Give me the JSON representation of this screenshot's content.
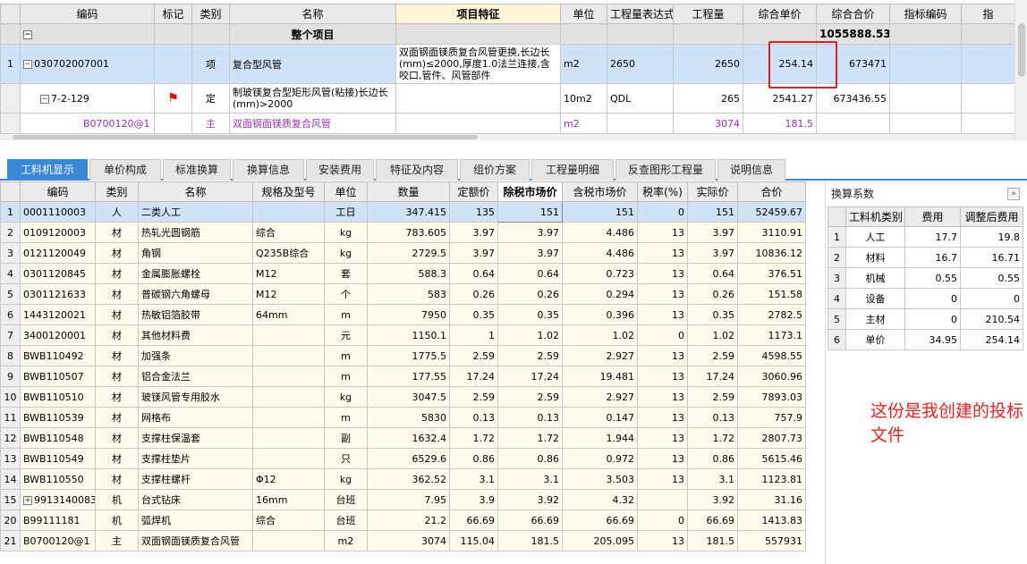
{
  "top_grid": {
    "headers": [
      "编码",
      "标记",
      "类别",
      "名称",
      "项目特征",
      "单位",
      "工程量表达式",
      "工程量",
      "综合单价",
      "综合合价",
      "指标编码",
      "指"
    ],
    "total_row": {
      "name": "整个项目",
      "total": "1055888.53"
    },
    "row1": {
      "num": "1",
      "code": "030702007001",
      "type": "项",
      "name": "复合型风管",
      "feature": "双面钢面镁质复合风管更换,长边长(mm)≤2000,厚度1.0法兰连接,含咬口,管件、风管部件",
      "unit": "m2",
      "expr": "2650",
      "qty": "2650",
      "price": "254.14",
      "total": "673471"
    },
    "row2": {
      "code": "7-2-129",
      "type": "定",
      "name": "制玻镁复合型矩形风管(粘接)长边长(mm)>2000",
      "unit": "10m2",
      "expr": "QDL",
      "qty": "265",
      "price": "2541.27",
      "total": "673436.55"
    },
    "row3": {
      "code": "B0700120@1",
      "type": "主",
      "name": "双面钢面镁质复合风管",
      "unit": "m2",
      "qty": "3074",
      "price": "181.5"
    }
  },
  "tabs": [
    "工料机显示",
    "单价构成",
    "标准换算",
    "换算信息",
    "安装费用",
    "特征及内容",
    "组价方案",
    "工程量明细",
    "反查图形工程量",
    "说明信息"
  ],
  "bottom_grid": {
    "headers": [
      "编码",
      "类别",
      "名称",
      "规格及型号",
      "单位",
      "数量",
      "定额价",
      "除税市场价",
      "含税市场价",
      "税率(%)",
      "实际价",
      "合价"
    ],
    "rows": [
      {
        "n": "1",
        "code": "0001110003",
        "type": "人",
        "name": "二类人工",
        "spec": "",
        "unit": "工日",
        "qty": "347.415",
        "base": "135",
        "mkt": "151",
        "mkt_tax": "151",
        "rate": "0",
        "real": "151",
        "total": "52459.67"
      },
      {
        "n": "2",
        "code": "0109120003",
        "type": "材",
        "name": "热轧光圆钢筋",
        "spec": "综合",
        "unit": "kg",
        "qty": "783.605",
        "base": "3.97",
        "mkt": "3.97",
        "mkt_tax": "4.486",
        "rate": "13",
        "real": "3.97",
        "total": "3110.91"
      },
      {
        "n": "3",
        "code": "0121120049",
        "type": "材",
        "name": "角钢",
        "spec": "Q235B综合",
        "unit": "kg",
        "qty": "2729.5",
        "base": "3.97",
        "mkt": "3.97",
        "mkt_tax": "4.486",
        "rate": "13",
        "real": "3.97",
        "total": "10836.12"
      },
      {
        "n": "4",
        "code": "0301120845",
        "type": "材",
        "name": "金属膨胀螺栓",
        "spec": "M12",
        "unit": "套",
        "qty": "588.3",
        "base": "0.64",
        "mkt": "0.64",
        "mkt_tax": "0.723",
        "rate": "13",
        "real": "0.64",
        "total": "376.51"
      },
      {
        "n": "5",
        "code": "0301121633",
        "type": "材",
        "name": "普碳钢六角螺母",
        "spec": "M12",
        "unit": "个",
        "qty": "583",
        "base": "0.26",
        "mkt": "0.26",
        "mkt_tax": "0.294",
        "rate": "13",
        "real": "0.26",
        "total": "151.58"
      },
      {
        "n": "6",
        "code": "1443120021",
        "type": "材",
        "name": "热敏铝箔胶带",
        "spec": "64mm",
        "unit": "m",
        "qty": "7950",
        "base": "0.35",
        "mkt": "0.35",
        "mkt_tax": "0.396",
        "rate": "13",
        "real": "0.35",
        "total": "2782.5"
      },
      {
        "n": "7",
        "code": "3400120001",
        "type": "材",
        "name": "其他材料费",
        "spec": "",
        "unit": "元",
        "qty": "1150.1",
        "base": "1",
        "mkt": "1.02",
        "mkt_tax": "1.02",
        "rate": "0",
        "real": "1.02",
        "total": "1173.1"
      },
      {
        "n": "8",
        "code": "BWB110492",
        "type": "材",
        "name": "加强条",
        "spec": "",
        "unit": "m",
        "qty": "1775.5",
        "base": "2.59",
        "mkt": "2.59",
        "mkt_tax": "2.927",
        "rate": "13",
        "real": "2.59",
        "total": "4598.55"
      },
      {
        "n": "9",
        "code": "BWB110507",
        "type": "材",
        "name": "铝合金法兰",
        "spec": "",
        "unit": "m",
        "qty": "177.55",
        "base": "17.24",
        "mkt": "17.24",
        "mkt_tax": "19.481",
        "rate": "13",
        "real": "17.24",
        "total": "3060.96"
      },
      {
        "n": "10",
        "code": "BWB110510",
        "type": "材",
        "name": "玻镁风管专用胶水",
        "spec": "",
        "unit": "kg",
        "qty": "3047.5",
        "base": "2.59",
        "mkt": "2.59",
        "mkt_tax": "2.927",
        "rate": "13",
        "real": "2.59",
        "total": "7893.03"
      },
      {
        "n": "11",
        "code": "BWB110539",
        "type": "材",
        "name": "网格布",
        "spec": "",
        "unit": "m",
        "qty": "5830",
        "base": "0.13",
        "mkt": "0.13",
        "mkt_tax": "0.147",
        "rate": "13",
        "real": "0.13",
        "total": "757.9"
      },
      {
        "n": "12",
        "code": "BWB110548",
        "type": "材",
        "name": "支撑柱保温套",
        "spec": "",
        "unit": "副",
        "qty": "1632.4",
        "base": "1.72",
        "mkt": "1.72",
        "mkt_tax": "1.944",
        "rate": "13",
        "real": "1.72",
        "total": "2807.73"
      },
      {
        "n": "13",
        "code": "BWB110549",
        "type": "材",
        "name": "支撑柱垫片",
        "spec": "",
        "unit": "只",
        "qty": "6529.6",
        "base": "0.86",
        "mkt": "0.86",
        "mkt_tax": "0.972",
        "rate": "13",
        "real": "0.86",
        "total": "5615.46"
      },
      {
        "n": "14",
        "code": "BWB110550",
        "type": "材",
        "name": "支撑柱螺杆",
        "spec": "Φ12",
        "unit": "kg",
        "qty": "362.52",
        "base": "3.1",
        "mkt": "3.1",
        "mkt_tax": "3.503",
        "rate": "13",
        "real": "3.1",
        "total": "1123.81"
      },
      {
        "n": "15",
        "code": "9913140083",
        "type": "机",
        "name": "台式钻床",
        "spec": "16mm",
        "unit": "台班",
        "qty": "7.95",
        "base": "3.9",
        "mkt": "3.92",
        "mkt_tax": "4.32",
        "rate": "",
        "real": "3.92",
        "total": "31.16",
        "expand": "+"
      },
      {
        "n": "20",
        "code": "B99111181",
        "type": "机",
        "name": "弧焊机",
        "spec": "综合",
        "unit": "台班",
        "qty": "21.2",
        "base": "66.69",
        "mkt": "66.69",
        "mkt_tax": "66.69",
        "rate": "0",
        "real": "66.69",
        "total": "1413.83"
      },
      {
        "n": "21",
        "code": "B0700120@1",
        "type": "主",
        "name": "双面钢面镁质复合风管",
        "spec": "",
        "unit": "m2",
        "qty": "3074",
        "base": "115.04",
        "mkt": "181.5",
        "mkt_tax": "205.095",
        "rate": "13",
        "real": "181.5",
        "total": "557931"
      }
    ]
  },
  "right_panel": {
    "title": "换算系数",
    "collapse_icon": "»",
    "headers": [
      "工料机类别",
      "费用",
      "调整后费用"
    ],
    "rows": [
      {
        "n": "1",
        "cat": "人工",
        "fee": "17.7",
        "adj": "19.8"
      },
      {
        "n": "2",
        "cat": "材料",
        "fee": "16.7",
        "adj": "16.71"
      },
      {
        "n": "3",
        "cat": "机械",
        "fee": "0.55",
        "adj": "0.55"
      },
      {
        "n": "4",
        "cat": "设备",
        "fee": "0",
        "adj": "0"
      },
      {
        "n": "5",
        "cat": "主材",
        "fee": "0",
        "adj": "210.54"
      },
      {
        "n": "6",
        "cat": "单价",
        "fee": "34.95",
        "adj": "254.14"
      }
    ]
  },
  "note": "这份是我创建的投标文件"
}
